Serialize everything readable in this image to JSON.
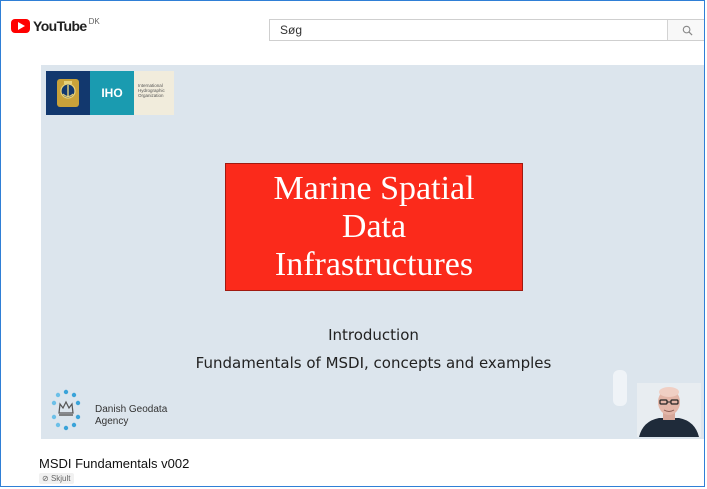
{
  "header": {
    "logo_text": "YouTube",
    "country": "DK",
    "search_placeholder": "Søg"
  },
  "slide": {
    "iho_abbrev": "IHO",
    "iho_org_lines": [
      "International",
      "Hydrographic",
      "Organization"
    ],
    "title_lines": [
      "Marine Spatial",
      "Data",
      "Infrastructures"
    ],
    "intro_line_1": "Introduction",
    "intro_line_2": "Fundamentals of MSDI, concepts and examples",
    "agency_lines": [
      "Danish Geodata",
      "Agency"
    ]
  },
  "video": {
    "title": "MSDI Fundamentals v002",
    "visibility": "Skjult"
  },
  "colors": {
    "youtube_red": "#ff0000",
    "title_box": "#fb2a1b",
    "slide_bg": "#dce5ed",
    "iho_navy": "#12386e",
    "iho_teal": "#1a9bb0"
  },
  "icons": [
    "youtube-play-icon",
    "search-icon",
    "iho-emblem-icon",
    "danish-geodata-crown-icon",
    "eye-slash-icon"
  ]
}
